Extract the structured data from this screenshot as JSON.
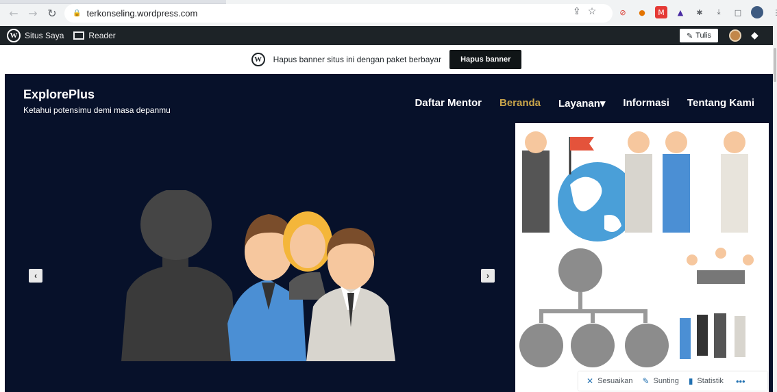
{
  "browser": {
    "url": "terkonseling.wordpress.com"
  },
  "adminbar": {
    "my_site": "Situs Saya",
    "reader": "Reader",
    "write": "Tulis"
  },
  "promo": {
    "text": "Hapus banner situs ini dengan paket berbayar",
    "button": "Hapus banner"
  },
  "site": {
    "title": "ExplorePlus",
    "tagline": "Ketahui potensimu demi masa depanmu",
    "menu": [
      "Daftar Mentor",
      "Beranda",
      "Layanan▾",
      "Informasi",
      "Tentang Kami"
    ],
    "active_menu": "Beranda",
    "accent_color": "#c9a54a",
    "background_color": "#07112a"
  },
  "toolbar": {
    "customize": "Sesuaikan",
    "edit": "Sunting",
    "stats": "Statistik",
    "more": "•••"
  }
}
